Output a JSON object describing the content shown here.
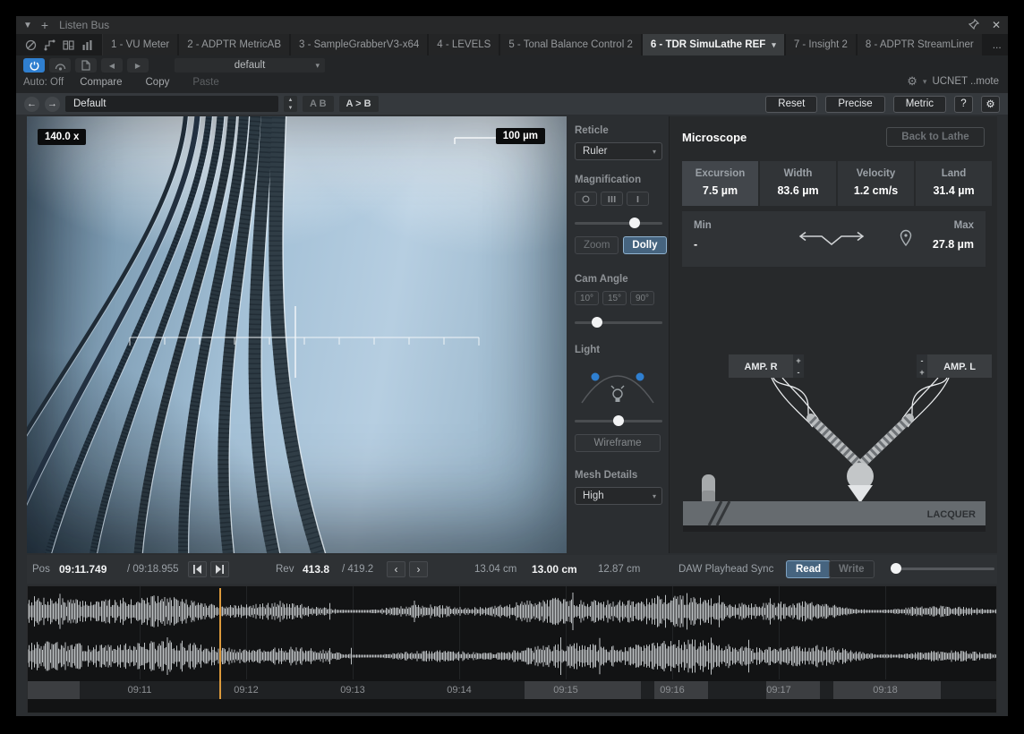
{
  "window": {
    "title": "Listen Bus"
  },
  "tabs": {
    "items": [
      {
        "label": "1 - VU Meter"
      },
      {
        "label": "2 - ADPTR MetricAB"
      },
      {
        "label": "3 - SampleGrabberV3-x64"
      },
      {
        "label": "4 - LEVELS"
      },
      {
        "label": "5 - Tonal Balance Control 2"
      },
      {
        "label": "6 - TDR SimuLathe REF"
      },
      {
        "label": "7 - Insight 2"
      },
      {
        "label": "8 - ADPTR StreamLiner"
      }
    ],
    "overflow": "..."
  },
  "toolbar": {
    "preset_value": "default",
    "auto_label": "Auto: Off",
    "compare_label": "Compare",
    "copy_label": "Copy",
    "paste_label": "Paste",
    "ucnet_label": "UCNET ..mote"
  },
  "header": {
    "preset_name": "Default",
    "ab_label": "A B",
    "ab_copy_label": "A > B",
    "reset_label": "Reset",
    "precise_label": "Precise",
    "metric_label": "Metric",
    "help_label": "?"
  },
  "viewport": {
    "magnification_badge": "140.0 x",
    "scale_badge": "100 µm"
  },
  "controls": {
    "reticle_label": "Reticle",
    "reticle_value": "Ruler",
    "magnification_label": "Magnification",
    "zoom_label": "Zoom",
    "dolly_label": "Dolly",
    "cam_angle_label": "Cam Angle",
    "angles": [
      {
        "label": "10°"
      },
      {
        "label": "15°"
      },
      {
        "label": "90°"
      }
    ],
    "light_label": "Light",
    "wireframe_label": "Wireframe",
    "mesh_label": "Mesh Details",
    "mesh_value": "High"
  },
  "microscope": {
    "title": "Microscope",
    "back_label": "Back to Lathe",
    "stats": [
      {
        "label": "Excursion",
        "value": "7.5 µm"
      },
      {
        "label": "Width",
        "value": "83.6 µm"
      },
      {
        "label": "Velocity",
        "value": "1.2 cm/s"
      },
      {
        "label": "Land",
        "value": "31.4 µm"
      }
    ],
    "min_label": "Min",
    "min_value": "-",
    "max_label": "Max",
    "max_value": "27.8 µm",
    "amp_r_label": "AMP. R",
    "amp_l_label": "AMP. L",
    "plus": "+",
    "minus": "-",
    "lacquer_label": "LACQUER"
  },
  "transport": {
    "pos_label": "Pos",
    "pos_value": "09:11.749",
    "pos_total": "/  09:18.955",
    "rev_label": "Rev",
    "rev_value": "413.8",
    "rev_total": "/  419.2",
    "radius_prev": "13.04 cm",
    "radius_current": "13.00 cm",
    "radius_next": "12.87 cm",
    "sync_label": "DAW Playhead Sync",
    "read_label": "Read",
    "write_label": "Write"
  },
  "timeline": {
    "ticks": [
      {
        "label": "09:11"
      },
      {
        "label": "09:12"
      },
      {
        "label": "09:13"
      },
      {
        "label": "09:14"
      },
      {
        "label": "09:15"
      },
      {
        "label": "09:16"
      },
      {
        "label": "09:17"
      },
      {
        "label": "09:18"
      }
    ]
  },
  "icons": {
    "caret": "▾",
    "close": "✕",
    "plus": "+",
    "back": "←",
    "forward": "→",
    "spin_up": "▲",
    "spin_down": "▼",
    "prev_tri": "◀",
    "next_tri": "▶",
    "chev_left": "‹",
    "chev_right": "›",
    "gear": "⚙",
    "help": "?"
  },
  "colors": {
    "accent_blue": "#2f7fd0",
    "active_control": "#46647f",
    "playhead_orange": "#dc9a3c"
  }
}
